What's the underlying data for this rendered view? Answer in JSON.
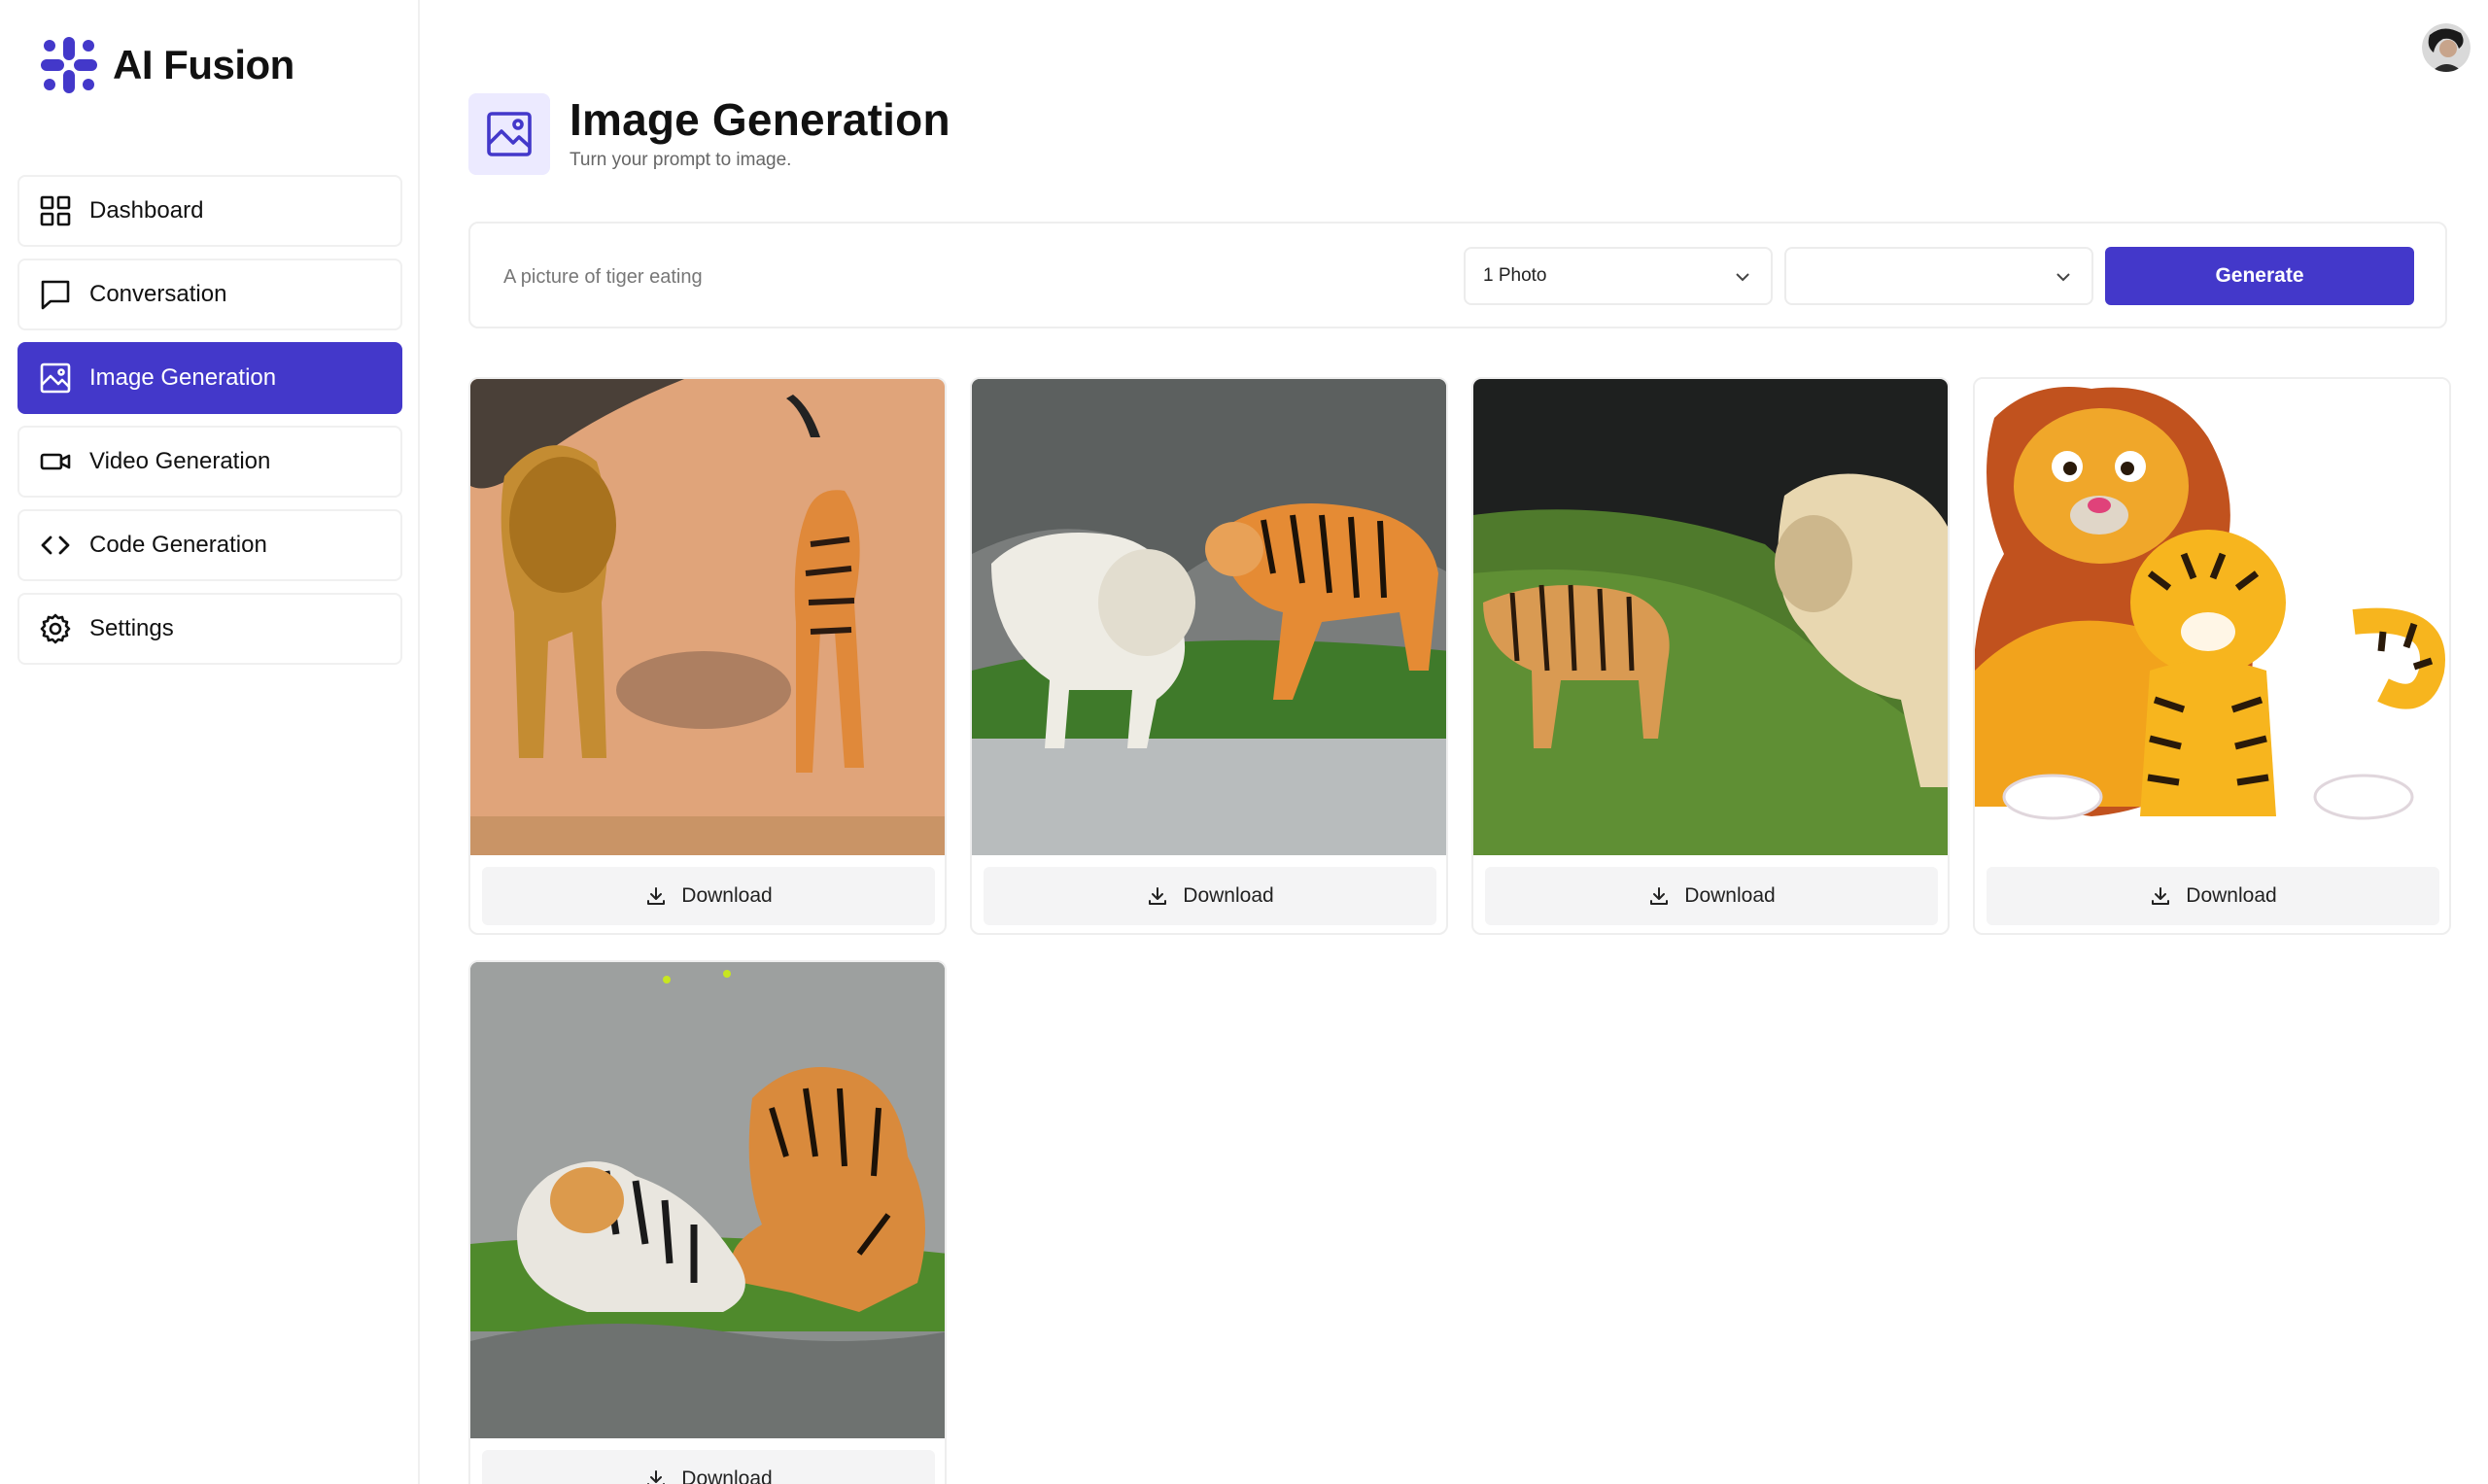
{
  "app": {
    "name": "AI Fusion"
  },
  "sidebar": {
    "items": [
      {
        "label": "Dashboard",
        "icon": "grid-icon",
        "active": false
      },
      {
        "label": "Conversation",
        "icon": "chat-icon",
        "active": false
      },
      {
        "label": "Image Generation",
        "icon": "image-icon",
        "active": true
      },
      {
        "label": "Video Generation",
        "icon": "video-icon",
        "active": false
      },
      {
        "label": "Code Generation",
        "icon": "code-icon",
        "active": false
      },
      {
        "label": "Settings",
        "icon": "gear-icon",
        "active": false
      }
    ]
  },
  "header": {
    "title": "Image Generation",
    "subtitle": "Turn your prompt to image."
  },
  "prompt": {
    "placeholder": "A picture of tiger eating",
    "value": "",
    "amount_selected": "1 Photo",
    "resolution_selected": "",
    "generate_label": "Generate"
  },
  "results": {
    "download_label": "Download",
    "images": [
      {
        "subject": "lion and tiger walking on sand"
      },
      {
        "subject": "white lion and tiger near rocks"
      },
      {
        "subject": "tiger and lion on grass"
      },
      {
        "subject": "cartoon lion and tiger cub"
      },
      {
        "subject": "two tigers resting on rocks"
      }
    ]
  },
  "colors": {
    "accent": "#4338ca",
    "accent_light": "#eceaff",
    "button_gray": "#f4f4f5"
  }
}
